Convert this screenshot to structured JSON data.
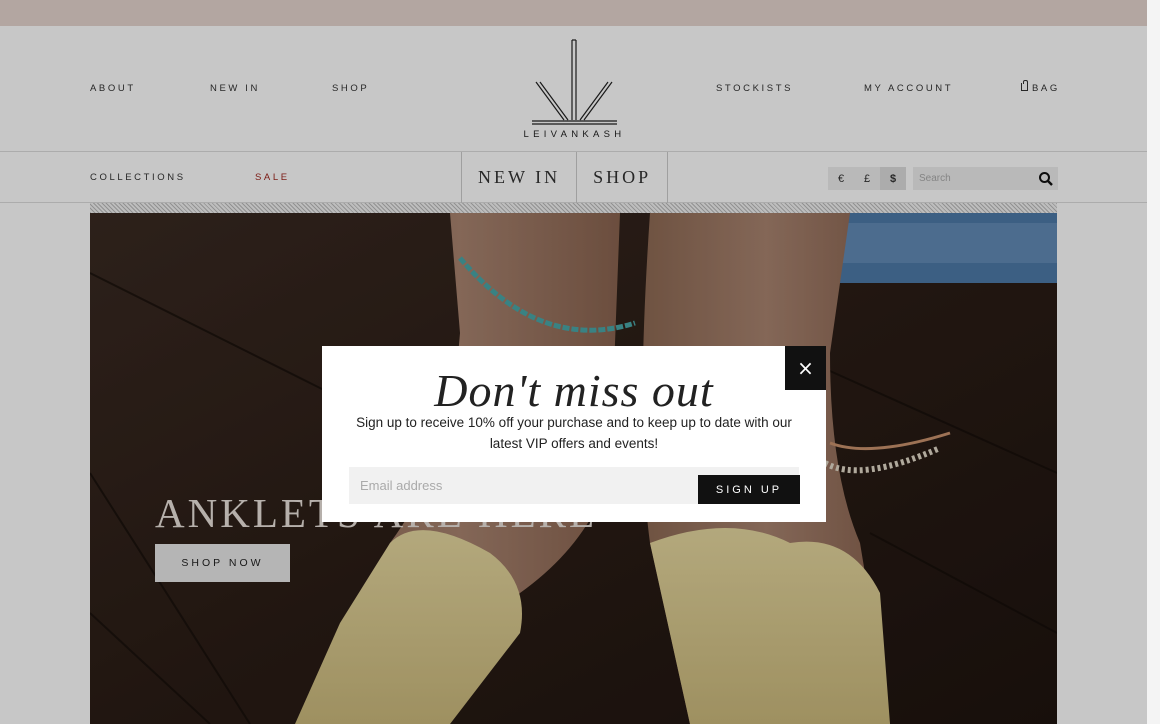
{
  "header": {
    "nav_left": [
      "ABOUT",
      "NEW IN",
      "SHOP"
    ],
    "nav_right": [
      "STOCKISTS",
      "MY ACCOUNT",
      "BAG"
    ],
    "logo_text": "LEIVANKASH"
  },
  "subnav": {
    "collections": "COLLECTIONS",
    "sale": "SALE",
    "big_tabs": [
      "NEW IN",
      "SHOP"
    ],
    "currencies": [
      "€",
      "£",
      "$"
    ],
    "active_currency": "$",
    "search_placeholder": "Search"
  },
  "hero": {
    "title": "ANKLETS ARE HERE",
    "button": "SHOP NOW"
  },
  "modal": {
    "title": "Don't miss out",
    "text": "Sign up to receive 10% off your purchase and to keep up to date with our latest VIP offers and events!",
    "email_placeholder": "Email address",
    "signup_label": "SIGN UP",
    "close_symbol": "×"
  },
  "icons": [
    "bag-icon",
    "search-icon",
    "close-icon",
    "logo-mark-icon"
  ],
  "colors": {
    "topbar": "#e6d5cf",
    "sale": "#a0271f",
    "button_dark": "#111111"
  }
}
